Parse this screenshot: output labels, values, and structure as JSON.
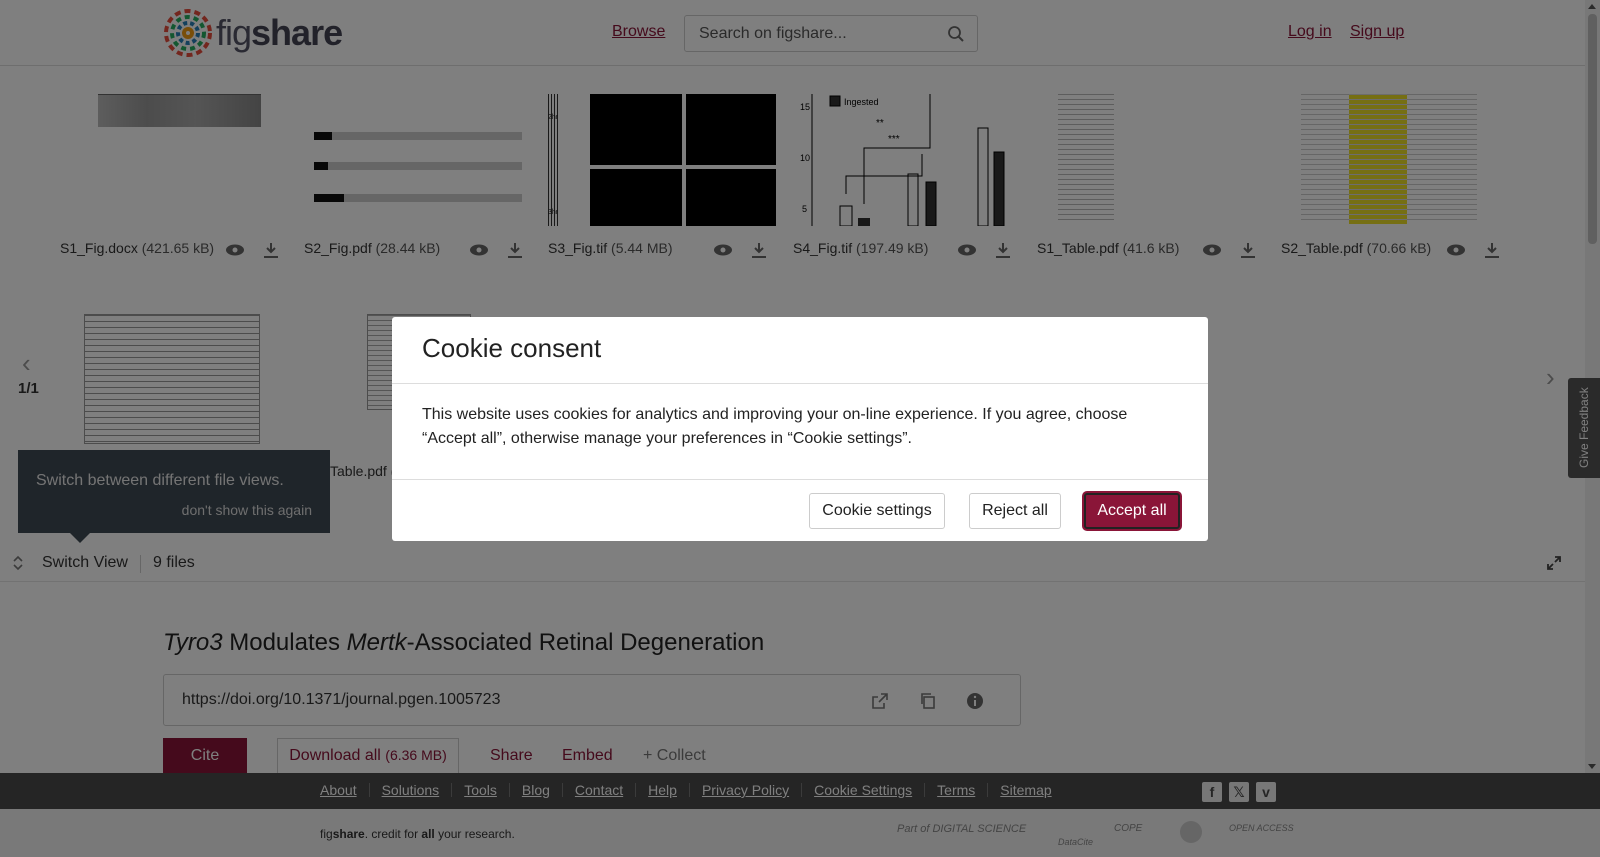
{
  "header": {
    "brand_prefix": "fig",
    "brand_suffix": "share",
    "browse": "Browse",
    "search_placeholder": "Search on figshare...",
    "login": "Log in",
    "signup": "Sign up"
  },
  "viewer": {
    "files": [
      {
        "name": "S1_Fig.docx",
        "size": "(421.65 kB)"
      },
      {
        "name": "S2_Fig.pdf",
        "size": "(28.44 kB)"
      },
      {
        "name": "S3_Fig.tif",
        "size": "(5.44 MB)"
      },
      {
        "name": "S4_Fig.tif",
        "size": "(197.49 kB)"
      },
      {
        "name": "S1_Table.pdf",
        "size": "(41.6 kB)"
      },
      {
        "name": "S2_Table.pdf",
        "size": "(70.66 kB)"
      },
      {
        "name": "Table.pdf (",
        "size": ""
      }
    ],
    "thumb_labels": {
      "s3_top": "2hr",
      "s3_bottom": "3hr",
      "s4_legend": "Ingested",
      "s4_ticks": [
        "15",
        "10",
        "5"
      ],
      "s4_stars": [
        "**",
        "***"
      ]
    },
    "pager": "1/1",
    "tooltip": {
      "text": "Switch between different file views.",
      "dismiss": "don't show this again"
    },
    "switch_view": "Switch View",
    "files_count": "9 files"
  },
  "article": {
    "title_parts": [
      "Tyro3",
      " Modulates ",
      "Mertk",
      "-Associated Retinal Degeneration"
    ],
    "doi": "https://doi.org/10.1371/journal.pgen.1005723",
    "cite": "Cite",
    "download_all": "Download all",
    "download_size": "(6.36 MB)",
    "share": "Share",
    "embed": "Embed",
    "collect": "+ Collect"
  },
  "footer": {
    "links": [
      "About",
      "Solutions",
      "Tools",
      "Blog",
      "Contact",
      "Help",
      "Privacy Policy",
      "Cookie Settings",
      "Terms",
      "Sitemap"
    ],
    "tagline_parts": [
      "fig",
      "share",
      ". credit for ",
      "all",
      " your research."
    ],
    "partners": [
      "Part of DIGITAL SCIENCE",
      "DataCite",
      "COPE",
      "",
      "OPEN ACCESS"
    ]
  },
  "feedback": "Give Feedback",
  "cookie_modal": {
    "title": "Cookie consent",
    "body": "This website uses cookies for analytics and improving your on-line experience. If you agree, choose “Accept all”, otherwise manage your preferences in “Cookie settings”.",
    "settings": "Cookie settings",
    "reject": "Reject all",
    "accept": "Accept all"
  },
  "colors": {
    "brand": "#8a1538",
    "footer_bg": "#4a4a4a",
    "overlay": "rgba(0,0,0,0.5)"
  }
}
